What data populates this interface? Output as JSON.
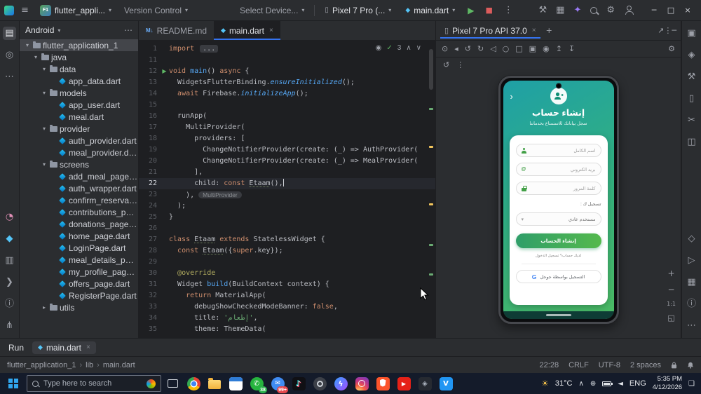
{
  "glyphs": {
    "hamburger": "≡",
    "chevron": "▾",
    "more_v": "⋮",
    "play": "▶",
    "stop": "■",
    "phone": "▯",
    "flutter": "◆",
    "markdown": "M↓",
    "close": "×",
    "min": "─",
    "max": "□",
    "eye": "◉",
    "check": "✓",
    "up": "∧",
    "down": "∨",
    "run_line": "▶",
    "back": "‹",
    "tree_open": "▾",
    "tree_closed": "▸",
    "more_h": "⋯",
    "plus": "+"
  },
  "title_bar": {
    "project_badge": "F1",
    "project_name": "flutter_appli...",
    "version_control": "Version Control",
    "select_device": "Select Device...",
    "device": "Pixel 7 Pro (...",
    "run_config": "main.dart",
    "icons": {
      "tools": "⚒",
      "layout": "▦",
      "ai": "✦",
      "settings": "⚙"
    }
  },
  "left_stripe": {
    "top": [
      {
        "name": "project-tool-icon",
        "glyph": "▤",
        "active": true
      },
      {
        "name": "commit-tool-icon",
        "glyph": "◎"
      },
      {
        "name": "more-tools-icon",
        "glyph": "⋯"
      }
    ],
    "bottom": [
      {
        "name": "insights-tool-icon",
        "glyph": "◔",
        "color": "#e08fb6"
      },
      {
        "name": "flutter-tool-icon",
        "glyph": "◆",
        "color": "#54c5f8"
      },
      {
        "name": "logcat-tool-icon",
        "glyph": "▥"
      },
      {
        "name": "terminal-tool-icon",
        "glyph": "❯"
      },
      {
        "name": "problems-tool-icon",
        "glyph": "ⓘ"
      },
      {
        "name": "git-tool-icon",
        "glyph": "⋔"
      }
    ]
  },
  "right_stripe": {
    "top": [
      {
        "name": "notifications-tool-icon",
        "glyph": "▣"
      },
      {
        "name": "gradle-tool-icon",
        "glyph": "◈"
      },
      {
        "name": "build-tool-icon",
        "glyph": "⚒"
      },
      {
        "name": "device-manager-tool-icon",
        "glyph": "▯"
      },
      {
        "name": "app-inspection-tool-icon",
        "glyph": "✂"
      },
      {
        "name": "structure-tool-icon",
        "glyph": "◫"
      }
    ],
    "bottom": [
      {
        "name": "layers-tool-icon",
        "glyph": "◇"
      },
      {
        "name": "run-anything-tool-icon",
        "glyph": "▷"
      },
      {
        "name": "todo-tool-icon",
        "glyph": "▦"
      },
      {
        "name": "info-tool-icon",
        "glyph": "ⓘ"
      },
      {
        "name": "more-right-tools-icon",
        "glyph": "⋯"
      }
    ]
  },
  "project_panel": {
    "view": "Android",
    "tree": [
      {
        "label": "flutter_application_1",
        "level": 0,
        "type": "folder",
        "expanded": true,
        "selected": true
      },
      {
        "label": "java",
        "level": 1,
        "type": "folder",
        "expanded": true
      },
      {
        "label": "data",
        "level": 2,
        "type": "folder",
        "expanded": true
      },
      {
        "label": "app_data.dart",
        "level": 3,
        "type": "dart"
      },
      {
        "label": "models",
        "level": 2,
        "type": "folder",
        "expanded": true
      },
      {
        "label": "app_user.dart",
        "level": 3,
        "type": "dart"
      },
      {
        "label": "meal.dart",
        "level": 3,
        "type": "dart"
      },
      {
        "label": "provider",
        "level": 2,
        "type": "folder",
        "expanded": true
      },
      {
        "label": "auth_provider.dart",
        "level": 3,
        "type": "dart"
      },
      {
        "label": "meal_provider.dart",
        "level": 3,
        "type": "dart"
      },
      {
        "label": "screens",
        "level": 2,
        "type": "folder",
        "expanded": true
      },
      {
        "label": "add_meal_page.da...",
        "level": 3,
        "type": "dart"
      },
      {
        "label": "auth_wrapper.dart",
        "level": 3,
        "type": "dart"
      },
      {
        "label": "confirm_reservati...",
        "level": 3,
        "type": "dart"
      },
      {
        "label": "contributions_pag...",
        "level": 3,
        "type": "dart"
      },
      {
        "label": "donations_page.d...",
        "level": 3,
        "type": "dart"
      },
      {
        "label": "home_page.dart",
        "level": 3,
        "type": "dart"
      },
      {
        "label": "LoginPage.dart",
        "level": 3,
        "type": "dart"
      },
      {
        "label": "meal_details_page...",
        "level": 3,
        "type": "dart"
      },
      {
        "label": "my_profile_page.d...",
        "level": 3,
        "type": "dart"
      },
      {
        "label": "offers_page.dart",
        "level": 3,
        "type": "dart"
      },
      {
        "label": "RegisterPage.dart",
        "level": 3,
        "type": "dart"
      },
      {
        "label": "utils",
        "level": 2,
        "type": "folder",
        "expanded": false
      }
    ]
  },
  "editor": {
    "tabs": [
      {
        "label": "README.md",
        "icon": "markdown",
        "active": false,
        "close": false
      },
      {
        "label": "main.dart",
        "icon": "flutter",
        "active": true,
        "close": true
      }
    ],
    "inspections": "3",
    "code": [
      {
        "n": "1",
        "t": [
          [
            "kw",
            "import"
          ],
          [
            "pl",
            " "
          ],
          [
            "fold",
            "..."
          ]
        ]
      },
      {
        "n": "11",
        "t": []
      },
      {
        "n": "12",
        "run": true,
        "t": [
          [
            "kw",
            "void"
          ],
          [
            "pl",
            " "
          ],
          [
            "fn",
            "main"
          ],
          [
            "pl",
            "() "
          ],
          [
            "kw",
            "async"
          ],
          [
            "pl",
            " {"
          ]
        ]
      },
      {
        "n": "13",
        "t": [
          [
            "pl",
            "  WidgetsFlutterBinding."
          ],
          [
            "mi",
            "ensureInitialized"
          ],
          [
            "pl",
            "();"
          ]
        ]
      },
      {
        "n": "14",
        "t": [
          [
            "pl",
            "  "
          ],
          [
            "kw",
            "await"
          ],
          [
            "pl",
            " Firebase."
          ],
          [
            "mi",
            "initializeApp"
          ],
          [
            "pl",
            "();"
          ]
        ]
      },
      {
        "n": "15",
        "t": []
      },
      {
        "n": "16",
        "t": [
          [
            "pl",
            "  runApp("
          ]
        ]
      },
      {
        "n": "17",
        "t": [
          [
            "pl",
            "    MultiProvider("
          ]
        ]
      },
      {
        "n": "18",
        "t": [
          [
            "pl",
            "      providers: ["
          ]
        ]
      },
      {
        "n": "19",
        "t": [
          [
            "pl",
            "        ChangeNotifierProvider(create: (_) => AuthProvider("
          ]
        ]
      },
      {
        "n": "20",
        "t": [
          [
            "pl",
            "        ChangeNotifierProvider(create: (_) => MealProvider("
          ]
        ]
      },
      {
        "n": "21",
        "t": [
          [
            "pl",
            "      ],"
          ]
        ]
      },
      {
        "n": "22",
        "current": true,
        "caret": true,
        "t": [
          [
            "pl",
            "      child: "
          ],
          [
            "kw",
            "const"
          ],
          [
            "pl",
            " "
          ],
          [
            "ty",
            "Etaam"
          ],
          [
            "pl",
            "(),"
          ]
        ]
      },
      {
        "n": "23",
        "t": [
          [
            "pl",
            "    ), "
          ],
          [
            "hint",
            "MultiProvider"
          ]
        ]
      },
      {
        "n": "24",
        "t": [
          [
            "pl",
            "  );"
          ]
        ]
      },
      {
        "n": "25",
        "t": [
          [
            "pl",
            "}"
          ]
        ]
      },
      {
        "n": "26",
        "t": []
      },
      {
        "n": "27",
        "t": [
          [
            "kw",
            "class"
          ],
          [
            "pl",
            " "
          ],
          [
            "ty",
            "Etaam"
          ],
          [
            "pl",
            " "
          ],
          [
            "kw",
            "extends"
          ],
          [
            "pl",
            " StatelessWidget {"
          ]
        ]
      },
      {
        "n": "28",
        "t": [
          [
            "pl",
            "  "
          ],
          [
            "kw",
            "const"
          ],
          [
            "pl",
            " "
          ],
          [
            "ty",
            "Etaam"
          ],
          [
            "pl",
            "({"
          ],
          [
            "kw",
            "super"
          ],
          [
            "pl",
            ".key});"
          ]
        ]
      },
      {
        "n": "29",
        "t": []
      },
      {
        "n": "30",
        "t": [
          [
            "pl",
            "  "
          ],
          [
            "an",
            "@override"
          ]
        ]
      },
      {
        "n": "31",
        "t": [
          [
            "pl",
            "  Widget "
          ],
          [
            "fn",
            "build"
          ],
          [
            "pl",
            "(BuildContext context) {"
          ]
        ]
      },
      {
        "n": "32",
        "t": [
          [
            "pl",
            "    "
          ],
          [
            "kw",
            "return"
          ],
          [
            "pl",
            " MaterialApp("
          ]
        ]
      },
      {
        "n": "33",
        "t": [
          [
            "pl",
            "      debugShowCheckedModeBanner: "
          ],
          [
            "kw",
            "false"
          ],
          [
            "pl",
            ","
          ]
        ]
      },
      {
        "n": "34",
        "t": [
          [
            "pl",
            "      title: "
          ],
          [
            "st",
            "'إطعام'"
          ],
          [
            "pl",
            ","
          ]
        ]
      },
      {
        "n": "35",
        "t": [
          [
            "pl",
            "      theme: ThemeData("
          ]
        ]
      }
    ]
  },
  "device_panel": {
    "tab": "Pixel 7 Pro API 37.0",
    "tab_actions": [
      {
        "name": "popout-icon",
        "glyph": "↗"
      },
      {
        "name": "panel-more-icon",
        "glyph": "⋮"
      },
      {
        "name": "hide-panel-icon",
        "glyph": "─"
      }
    ],
    "toolbar": [
      {
        "name": "power-button",
        "glyph": "⊙"
      },
      {
        "name": "volume-button",
        "glyph": "◂"
      },
      {
        "name": "rotate-left-button",
        "glyph": "↺"
      },
      {
        "name": "rotate-right-button",
        "glyph": "↻"
      },
      {
        "name": "android-back-button",
        "glyph": "◁"
      },
      {
        "name": "android-home-button",
        "glyph": "○"
      },
      {
        "name": "android-overview-button",
        "glyph": "□"
      },
      {
        "name": "screenshot-button",
        "glyph": "▣"
      },
      {
        "name": "record-button",
        "glyph": "◉"
      },
      {
        "name": "share-button",
        "glyph": "↥"
      },
      {
        "name": "save-button",
        "glyph": "↧"
      }
    ],
    "toolbar_right": [
      {
        "name": "device-settings-icon",
        "glyph": "⚙"
      }
    ],
    "toolbar2": [
      {
        "name": "reload-icon",
        "glyph": "↺"
      },
      {
        "name": "toolbar-more-icon",
        "glyph": "⋮"
      }
    ],
    "zoom": {
      "in": "+",
      "out": "−",
      "reset": "1:1",
      "fit": "◱"
    },
    "app": {
      "title": "إنشاء حساب",
      "subtitle": "سجل بياناتك للاستمتاع بخدماتنا",
      "fields": [
        {
          "placeholder": "اسم الكامل",
          "icon": "person"
        },
        {
          "placeholder": "بريد الكتروني",
          "icon": "email",
          "glyph": "@"
        },
        {
          "placeholder": "كلمة المرور",
          "icon": "lock"
        }
      ],
      "register_as_label": "تسجيل ك :",
      "role_value": "مستخدم عادي",
      "submit_label": "إنشاء الحساب",
      "login_hint": "لديك حساب؟ تسجيل الدخول",
      "google_label": "التسجيل بواسطة جوجل",
      "google_g": "G"
    }
  },
  "run_bar": {
    "label": "Run",
    "tab": "main.dart"
  },
  "status_bar": {
    "breadcrumb": [
      "flutter_application_1",
      "lib",
      "main.dart"
    ],
    "caret": "22:28",
    "line_sep": "CRLF",
    "encoding": "UTF-8",
    "indent": "2 spaces"
  },
  "taskbar": {
    "search_placeholder": "Type here to search",
    "apps": [
      {
        "name": "task-view-button",
        "kind": "taskview"
      },
      {
        "name": "chrome-icon",
        "kind": "chrome"
      },
      {
        "name": "file-explorer-icon",
        "kind": "folder"
      },
      {
        "name": "calendar-icon",
        "kind": "calendar"
      },
      {
        "name": "whatsapp-icon",
        "kind": "whatsapp",
        "glyph": "✆",
        "badge": "38",
        "badge_color": "green"
      },
      {
        "name": "mail-icon",
        "kind": "mail",
        "glyph": "✉",
        "badge": "99+",
        "badge_color": "red"
      },
      {
        "name": "tiktok-icon",
        "kind": "tiktok",
        "glyph": "♪"
      },
      {
        "name": "camera-icon",
        "kind": "camera"
      },
      {
        "name": "messenger-icon",
        "kind": "messenger",
        "glyph": "ϟ"
      },
      {
        "name": "instagram-icon",
        "kind": "instagram"
      },
      {
        "name": "brave-icon",
        "kind": "brave"
      },
      {
        "name": "youtube-icon",
        "kind": "youtube",
        "glyph": "▶"
      },
      {
        "name": "media-app-icon",
        "kind": "dark",
        "glyph": "◈"
      },
      {
        "name": "vscode-icon",
        "kind": "vscode",
        "glyph": "V"
      }
    ],
    "tray": {
      "temp": "31°C",
      "sun": "☀",
      "chevron": "∧",
      "network": "⊕",
      "volume": "◄",
      "lang": "ENG",
      "time": "5:35 PM",
      "date": "4/12/2026",
      "notification": "❏"
    }
  }
}
